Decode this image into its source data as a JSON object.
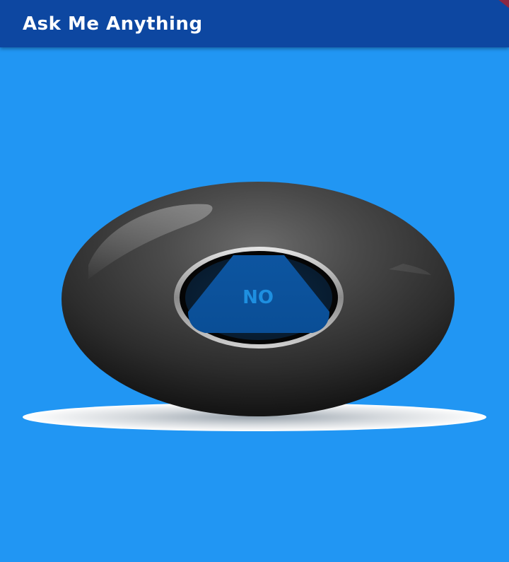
{
  "app_bar": {
    "title": "Ask Me Anything",
    "color": "#0D47A1"
  },
  "background_color": "#2196F3",
  "ball": {
    "answer": "NO",
    "answer_color": "#1E8FE0",
    "window_color": "#0F5FA8"
  }
}
